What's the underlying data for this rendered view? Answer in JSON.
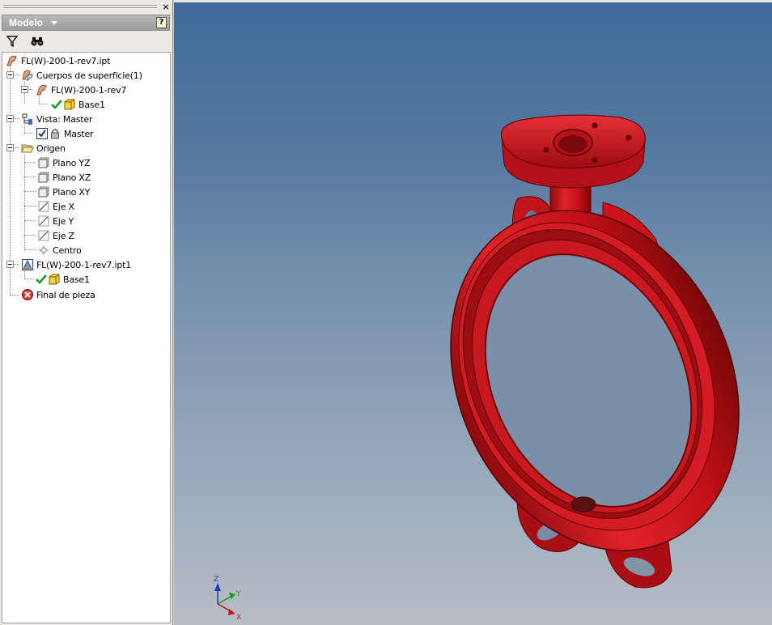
{
  "panel": {
    "close_label": "×",
    "header_title": "Modelo",
    "help_label": "?",
    "toolbar": {
      "filter_icon": "filter-icon",
      "find_icon": "binoculars-icon"
    }
  },
  "tree": {
    "root": "FL(W)-200-1-rev7.ipt",
    "surface_bodies": "Cuerpos de superficie(1)",
    "body": "FL(W)-200-1-rev7",
    "body_feature": "Base1",
    "view": "Vista: Master",
    "view_item": "Master",
    "origin": "Origen",
    "origin_items": [
      "Plano YZ",
      "Plano XZ",
      "Plano XY",
      "Eje X",
      "Eje Y",
      "Eje Z",
      "Centro"
    ],
    "derived": "FL(W)-200-1-rev7.ipt1",
    "derived_feature": "Base1",
    "end": "Final de pieza"
  },
  "triad": {
    "z": "Z",
    "y": "Y",
    "x": "X"
  },
  "colors": {
    "part_red": "#d0141a",
    "bg_top": "#3f6a9a",
    "bg_bottom": "#b6bdc6"
  }
}
